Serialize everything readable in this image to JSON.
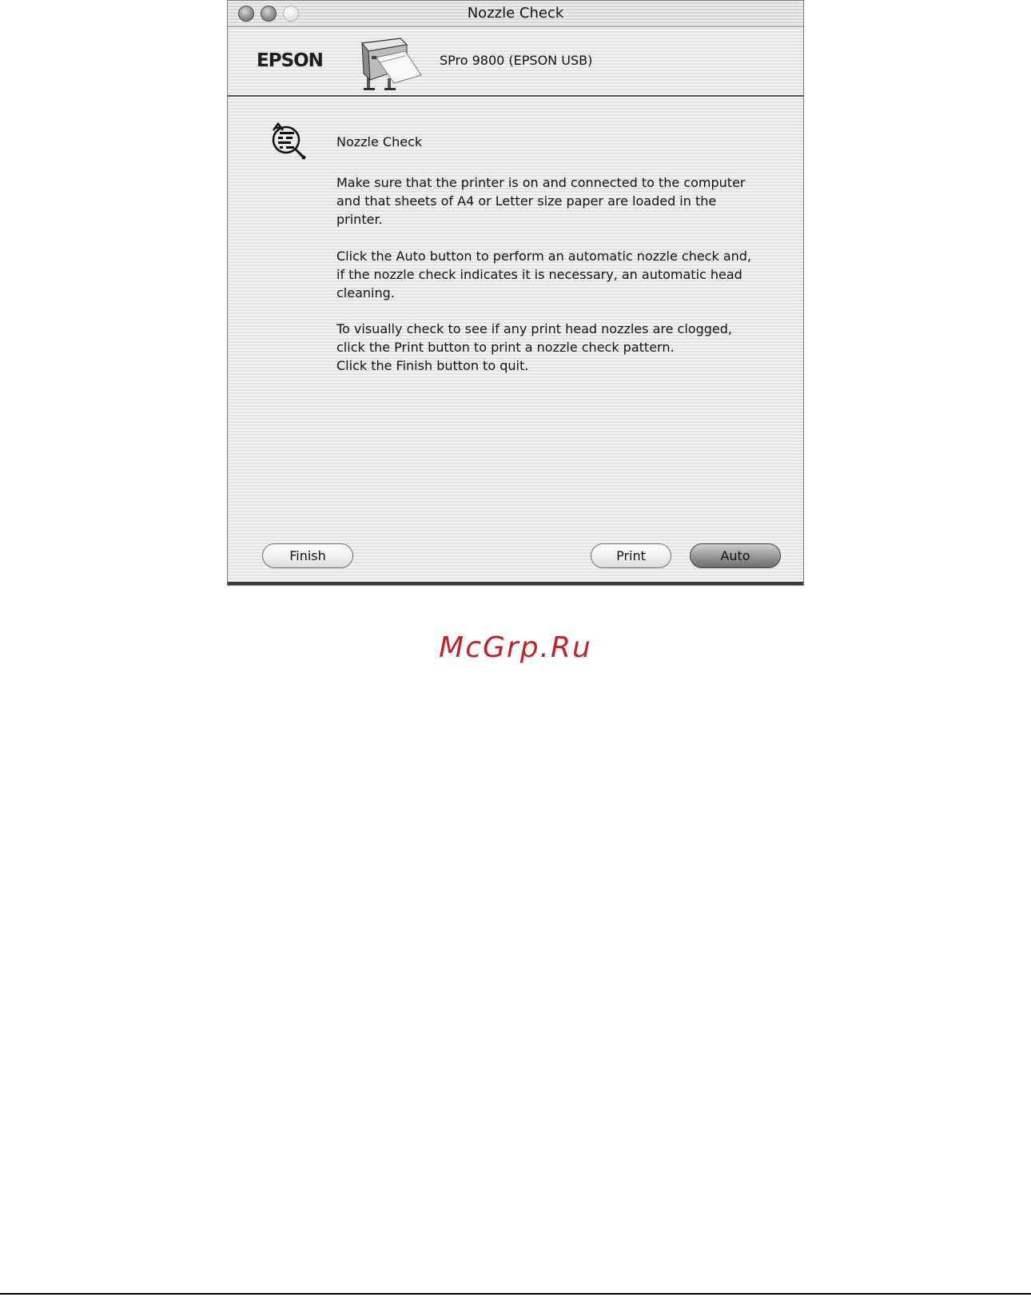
{
  "window": {
    "title": "Nozzle Check"
  },
  "header": {
    "brand": "EPSON",
    "printer_name": "SPro 9800 (EPSON USB)"
  },
  "content": {
    "section_title": "Nozzle Check",
    "paragraphs": [
      "Make sure that the printer is on and connected to the computer\nand that sheets of A4 or Letter size paper are loaded in the\nprinter.",
      "Click the Auto button to perform an automatic nozzle check and,\nif the nozzle check indicates it is necessary, an automatic head\ncleaning.",
      "To visually check to see if any print head nozzles are clogged,\nclick the Print button to print a nozzle check pattern.\nClick the Finish button to quit."
    ]
  },
  "buttons": {
    "finish": "Finish",
    "print": "Print",
    "auto": "Auto"
  },
  "watermark": "McGrp.Ru",
  "icons": {
    "close": "close-icon",
    "minimize": "minimize-icon",
    "zoom": "zoom-icon",
    "printer": "printer-icon",
    "nozzle": "nozzle-check-icon"
  }
}
